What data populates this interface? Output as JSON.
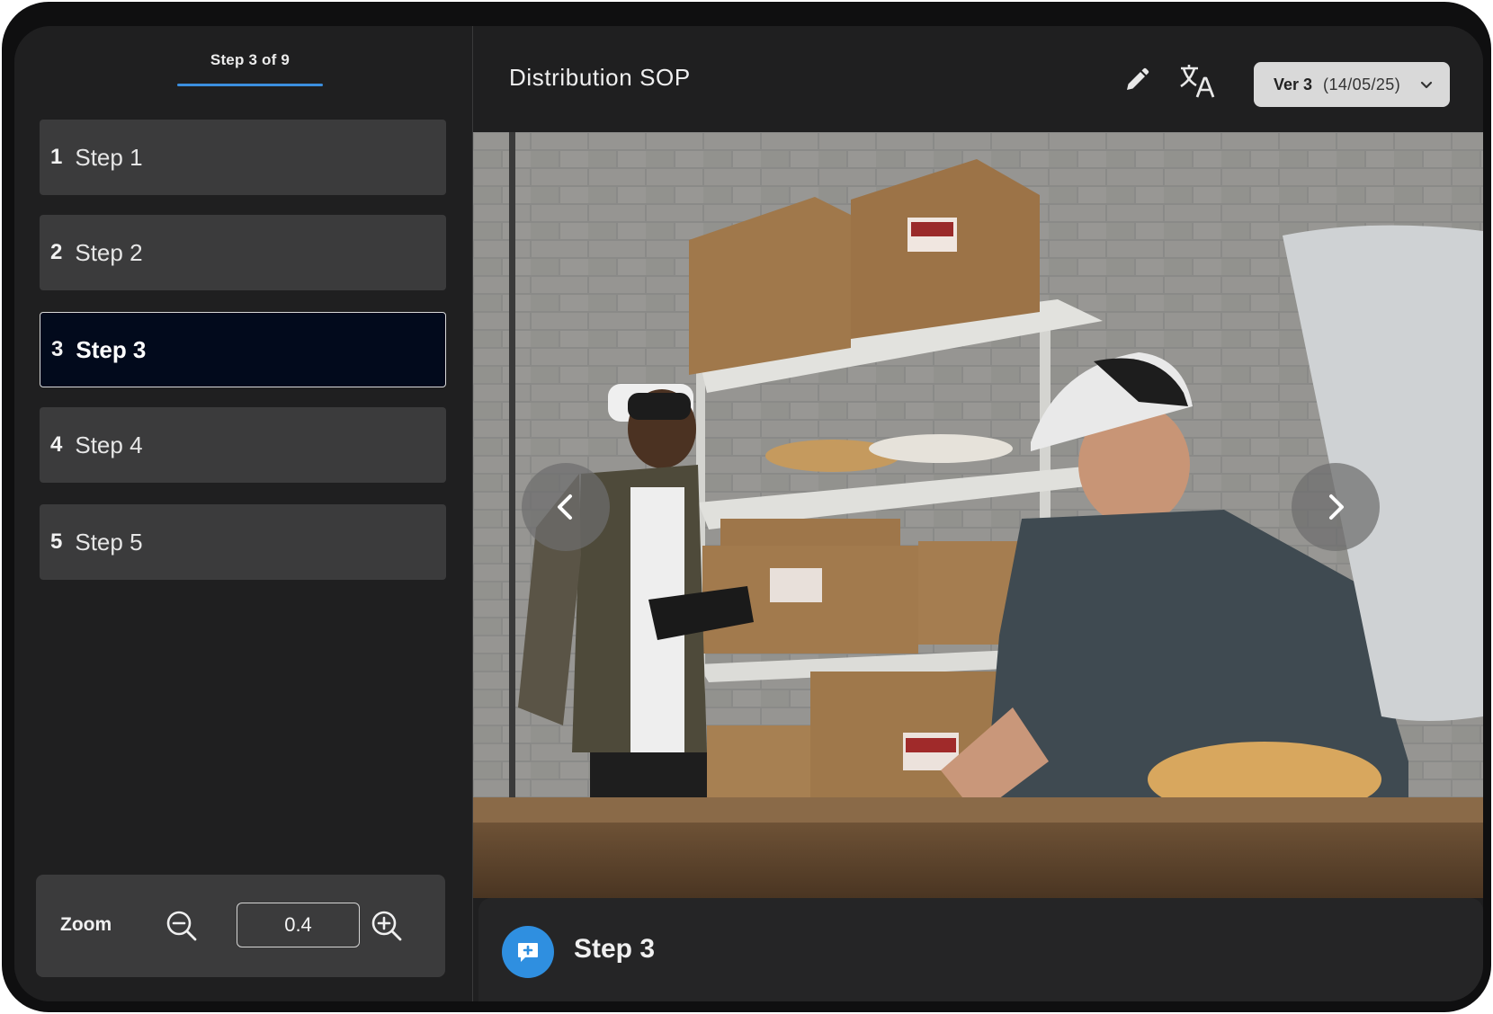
{
  "sidebar": {
    "step_counter": "Step 3 of 9",
    "items": [
      {
        "number": "1",
        "label": "Step 1"
      },
      {
        "number": "2",
        "label": "Step 2"
      },
      {
        "number": "3",
        "label": "Step 3",
        "active": true
      },
      {
        "number": "4",
        "label": "Step 4"
      },
      {
        "number": "5",
        "label": "Step 5"
      }
    ],
    "zoom": {
      "label": "Zoom",
      "value": "0.4",
      "zoom_out_icon": "zoom-out-icon",
      "zoom_in_icon": "zoom-in-icon"
    }
  },
  "header": {
    "title": "Distribution SOP",
    "edit_icon": "pencil-icon",
    "translate_icon": "translate-icon",
    "version": {
      "label": "Ver 3",
      "date": "(14/05/25)"
    }
  },
  "media": {
    "prev_icon": "chevron-left-icon",
    "next_icon": "chevron-right-icon"
  },
  "caption": {
    "comment_icon": "add-comment-icon",
    "text": "Step 3"
  },
  "colors": {
    "accent": "#2f8fe0",
    "active_step_bg": "#020a1c",
    "step_bg": "#3b3b3c",
    "panel_bg": "#1f1f20"
  }
}
